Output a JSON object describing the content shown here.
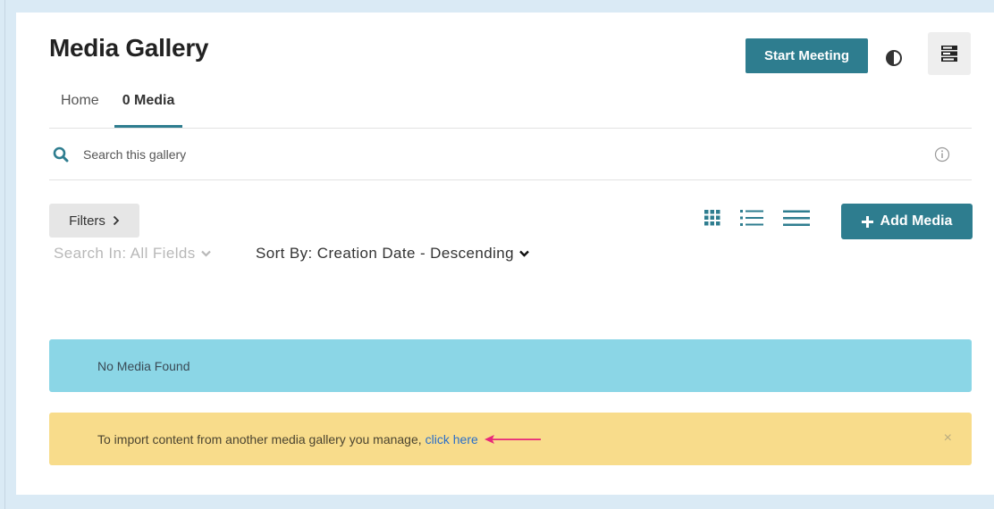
{
  "header": {
    "title": "Media Gallery",
    "start_meeting_label": "Start Meeting",
    "contrast_icon": "contrast-icon",
    "menu_icon": "menu-icon"
  },
  "tabs": [
    {
      "label": "Home",
      "active": false
    },
    {
      "label": "0 Media",
      "active": true
    }
  ],
  "search": {
    "placeholder": "Search this gallery",
    "value": ""
  },
  "toolbar": {
    "filters_label": "Filters",
    "add_media_label": "Add Media",
    "view_icons": [
      "grid-view-icon",
      "detailed-list-view-icon",
      "list-view-icon"
    ]
  },
  "options": {
    "search_in_label": "Search In: All Fields",
    "sort_by_label": "Sort By: Creation Date - Descending"
  },
  "alerts": {
    "no_media_text": "No Media Found",
    "import_text": "To import content from another media gallery you manage,",
    "import_link": "click here",
    "close_symbol": "×"
  },
  "colors": {
    "accent": "#2e7d8f",
    "info_bg": "#8bd6e6",
    "warning_bg": "#f8dc8b",
    "annotation_arrow": "#e8287a"
  }
}
